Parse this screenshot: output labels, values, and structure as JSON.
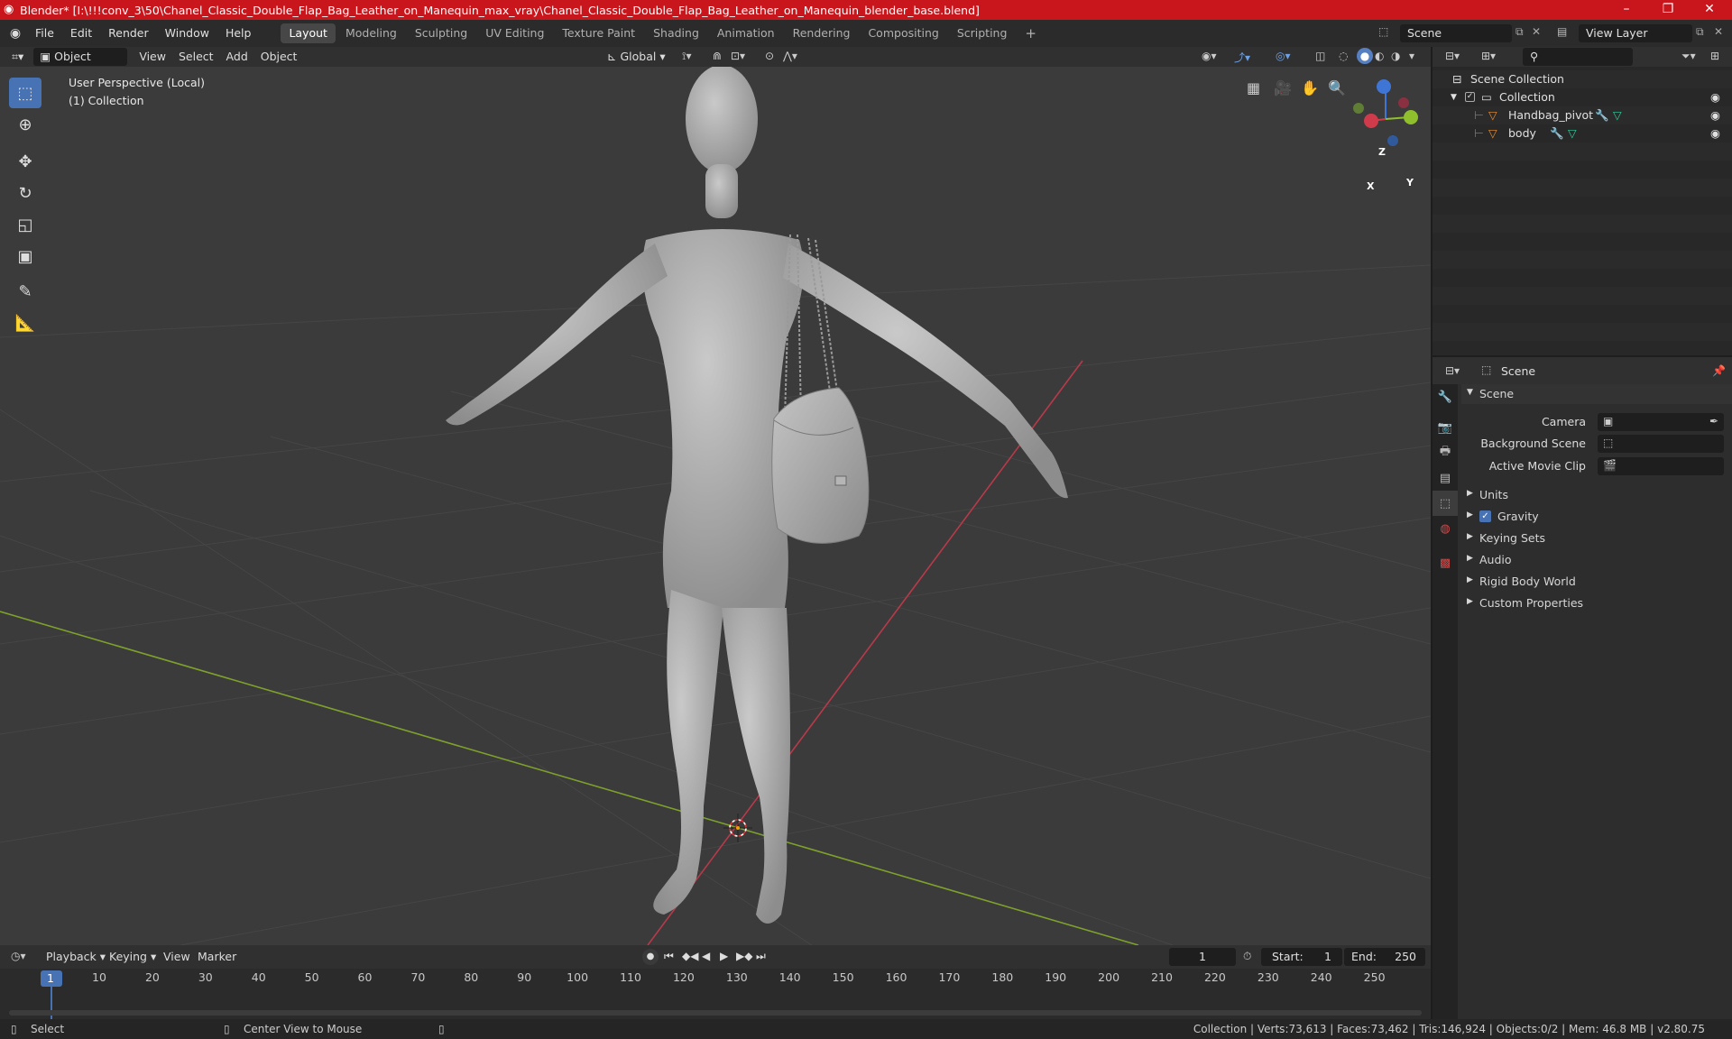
{
  "window": {
    "title": "Blender* [I:\\!!!conv_3\\50\\Chanel_Classic_Double_Flap_Bag_Leather_on_Manequin_max_vray\\Chanel_Classic_Double_Flap_Bag_Leather_on_Manequin_blender_base.blend]",
    "minimize": "–",
    "maximize": "❐",
    "close": "✕"
  },
  "menus": [
    "File",
    "Edit",
    "Render",
    "Window",
    "Help"
  ],
  "workspaces": [
    "Layout",
    "Modeling",
    "Sculpting",
    "UV Editing",
    "Texture Paint",
    "Shading",
    "Animation",
    "Rendering",
    "Compositing",
    "Scripting"
  ],
  "add_workspace": "+",
  "scene_selector": "Scene",
  "view_layer_selector": "View Layer",
  "viewport_header": {
    "mode": "Object Mode",
    "view": "View",
    "select": "Select",
    "add": "Add",
    "object": "Object",
    "transform_orientation": "Global"
  },
  "viewport": {
    "perspective": "User Perspective (Local)",
    "collection": "(1) Collection",
    "gizmo": {
      "z": "Z",
      "y": "Y",
      "x": "X"
    }
  },
  "outliner": {
    "search_placeholder": "",
    "scene_collection": "Scene Collection",
    "collection": "Collection",
    "items": [
      "Handbag_pivot",
      "body"
    ]
  },
  "properties": {
    "header": "Scene",
    "section": "Scene",
    "camera_label": "Camera",
    "background_scene_label": "Background Scene",
    "active_movie_clip_label": "Active Movie Clip",
    "panels": [
      "Units",
      "Gravity",
      "Keying Sets",
      "Audio",
      "Rigid Body World",
      "Custom Properties"
    ],
    "gravity_checked": true
  },
  "timeline": {
    "playback": "Playback",
    "keying": "Keying",
    "view": "View",
    "marker": "Marker",
    "current_frame": "1",
    "start_label": "Start:",
    "start": "1",
    "end_label": "End:",
    "end": "250",
    "ticks": [
      "1",
      "10",
      "20",
      "30",
      "40",
      "50",
      "60",
      "70",
      "80",
      "90",
      "100",
      "110",
      "120",
      "130",
      "140",
      "150",
      "160",
      "170",
      "180",
      "190",
      "200",
      "210",
      "220",
      "230",
      "240",
      "250"
    ]
  },
  "status": {
    "select": "Select",
    "center_view": "Center View to Mouse",
    "stats": "Collection | Verts:73,613 | Faces:73,462 | Tris:146,924 | Objects:0/2 | Mem: 46.8 MB | v2.80.75"
  },
  "colors": {
    "titlebar": "#c8161c",
    "accent": "#4772b3",
    "axis_x": "#d03b4b",
    "axis_y": "#8fbf2c",
    "axis_z": "#3f76d6"
  }
}
